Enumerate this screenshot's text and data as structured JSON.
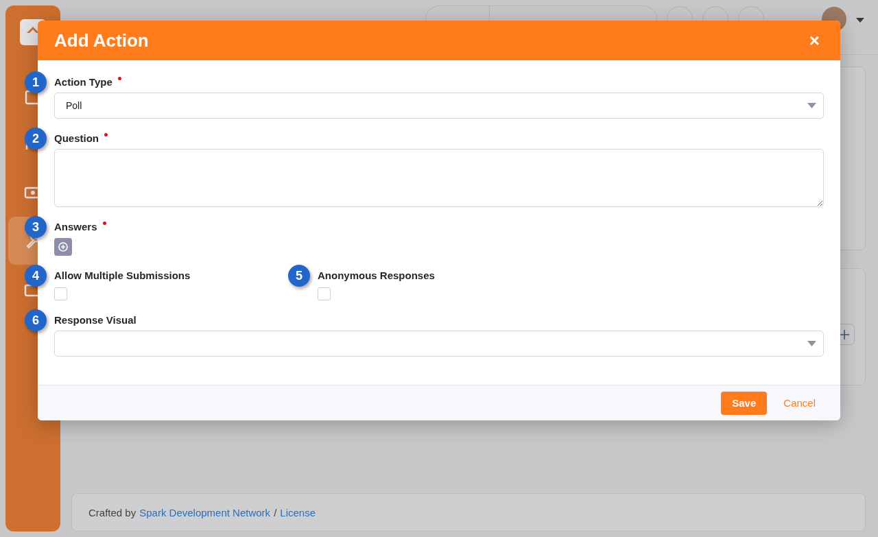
{
  "modal": {
    "title": "Add Action",
    "close": "×",
    "fields": [
      {
        "kind": "select",
        "callout": "1",
        "label": "Action Type",
        "required": true,
        "value": "Poll"
      },
      {
        "kind": "textarea",
        "callout": "2",
        "label": "Question",
        "required": true
      },
      {
        "kind": "list",
        "callout": "3",
        "label": "Answers",
        "required": true
      },
      {
        "kind": "checkboxes",
        "items": [
          {
            "callout": "4",
            "label": "Allow Multiple Submissions",
            "checked": false
          },
          {
            "callout": "5",
            "label": "Anonymous Responses",
            "checked": false
          }
        ]
      },
      {
        "kind": "select",
        "callout": "6",
        "label": "Response Visual"
      }
    ],
    "buttons": [
      {
        "label": "Save",
        "kind": "primary"
      },
      {
        "label": "Cancel",
        "kind": "link"
      }
    ]
  },
  "footer": {
    "text": "Crafted by",
    "links": [
      "Spark Development Network",
      "License"
    ],
    "separator": "/"
  }
}
